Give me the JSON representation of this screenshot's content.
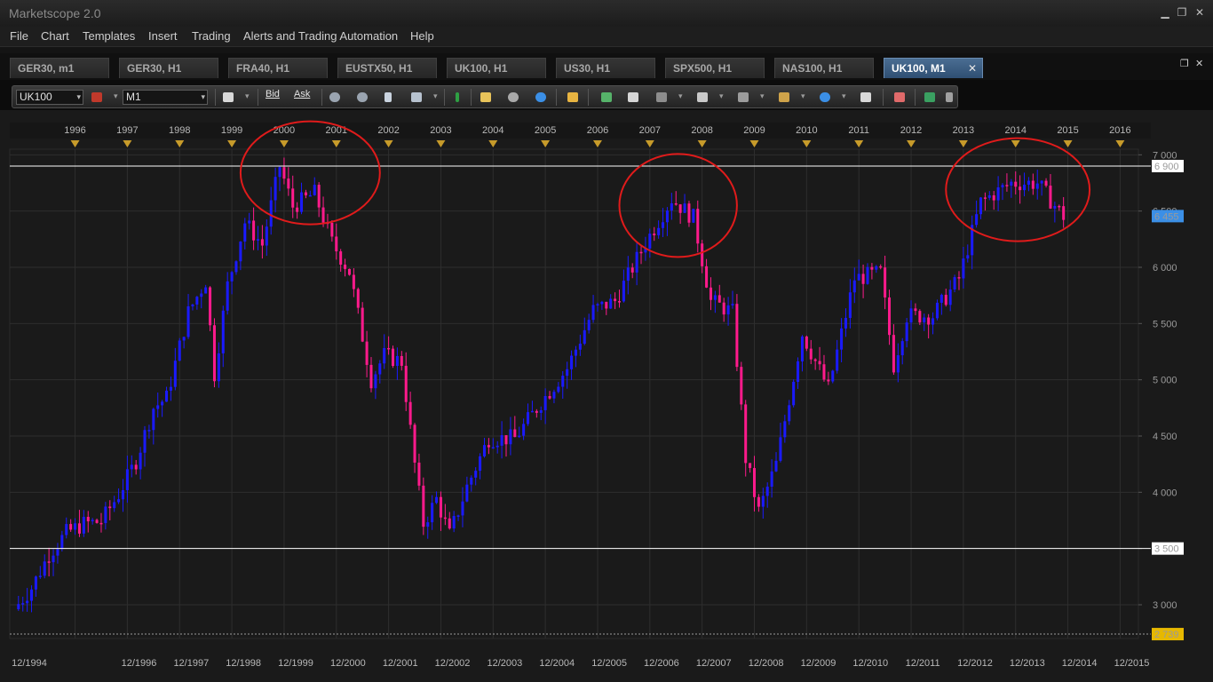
{
  "app": {
    "title": "Marketscope 2.0"
  },
  "window_controls": {
    "minimize": "▁",
    "restore": "❐",
    "close": "✕",
    "chart_restore": "❐",
    "chart_close": "✕"
  },
  "menu": [
    "File",
    "Chart",
    "Templates",
    "Insert",
    "Trading",
    "Alerts and Trading Automation",
    "Help"
  ],
  "tabs": [
    {
      "label": "GER30, m1",
      "active": false
    },
    {
      "label": "GER30, H1",
      "active": false
    },
    {
      "label": "FRA40, H1",
      "active": false
    },
    {
      "label": "EUSTX50, H1",
      "active": false
    },
    {
      "label": "UK100, H1",
      "active": false
    },
    {
      "label": "US30, H1",
      "active": false
    },
    {
      "label": "SPX500, H1",
      "active": false
    },
    {
      "label": "NAS100, H1",
      "active": false
    },
    {
      "label": "UK100, M1",
      "active": true
    }
  ],
  "tab_close": "✕",
  "toolbar": {
    "instrument": "UK100",
    "timeframe": "M1",
    "bid_label": "Bid",
    "ask_label": "Ask",
    "dropdown_glyph": "▾",
    "icons": [
      "chart-type-icon",
      "bid-icon",
      "ask-icon",
      "person-icon",
      "person2-icon",
      "cursor-icon",
      "zoom-icon",
      "crosshair-icon",
      "note-icon",
      "eye-icon",
      "globe-icon",
      "ruler-icon",
      "image-icon",
      "window-icon",
      "fibonacci-icon",
      "channel-icon",
      "trendline-icon",
      "line-icon",
      "ellipse-icon",
      "text-icon",
      "eraser-icon",
      "tree-icon",
      "menu-icon"
    ],
    "colors": {
      "accent_bid": "#4a90d9",
      "accent_ask": "#d94a4a"
    }
  },
  "chart_data": {
    "type": "candlestick",
    "instrument": "UK100",
    "timeframe": "M1",
    "top_axis_years": [
      "1996",
      "1997",
      "1998",
      "1999",
      "2000",
      "2001",
      "2002",
      "2003",
      "2004",
      "2005",
      "2006",
      "2007",
      "2008",
      "2009",
      "2010",
      "2011",
      "2012",
      "2013",
      "2014",
      "2015",
      "2016"
    ],
    "bottom_axis_labels": [
      "12/1994",
      "12/1996",
      "12/1997",
      "12/1998",
      "12/1999",
      "12/2000",
      "12/2001",
      "12/2002",
      "12/2003",
      "12/2004",
      "12/2005",
      "12/2006",
      "12/2007",
      "12/2008",
      "12/2009",
      "12/2010",
      "12/2011",
      "12/2012",
      "12/2013",
      "12/2014",
      "12/2015"
    ],
    "y_ticks": [
      "3 000",
      "3 500",
      "4 000",
      "4 500",
      "5 000",
      "5 500",
      "6 000",
      "6 500",
      "7 000"
    ],
    "ylim": [
      2700,
      7050
    ],
    "horizontal_lines": [
      {
        "value": 6900,
        "label": "6 900"
      },
      {
        "value": 3500,
        "label": "3 500"
      }
    ],
    "price_markers": [
      {
        "value": 6455,
        "label": "6 455",
        "color": "#3b8fe6"
      },
      {
        "value": 2739,
        "label": "2 739",
        "color": "#e6b800"
      }
    ],
    "colors": {
      "up": "#1a1aff",
      "down": "#ff1a8c",
      "background": "#1a1a1a",
      "grid": "#2e2e2e",
      "circles": "#e01b1b"
    },
    "highlight_circles": [
      {
        "from": "1999-03",
        "to": "2001-11"
      },
      {
        "from": "2006-06",
        "to": "2008-09"
      },
      {
        "from": "2012-09",
        "to": "2015-06"
      }
    ],
    "close_series": [
      {
        "period": "1994-11",
        "close": 2960
      },
      {
        "period": "1995-03",
        "close": 3150
      },
      {
        "period": "1995-07",
        "close": 3450
      },
      {
        "period": "1995-11",
        "close": 3640
      },
      {
        "period": "1996-03",
        "close": 3720
      },
      {
        "period": "1996-07",
        "close": 3740
      },
      {
        "period": "1996-11",
        "close": 3980
      },
      {
        "period": "1997-03",
        "close": 4280
      },
      {
        "period": "1997-07",
        "close": 4750
      },
      {
        "period": "1997-10",
        "close": 4840
      },
      {
        "period": "1998-03",
        "close": 5600
      },
      {
        "period": "1998-07",
        "close": 5880
      },
      {
        "period": "1998-09",
        "close": 5050
      },
      {
        "period": "1998-12",
        "close": 5840
      },
      {
        "period": "1999-04",
        "close": 6400
      },
      {
        "period": "1999-08",
        "close": 6200
      },
      {
        "period": "1999-12",
        "close": 6900
      },
      {
        "period": "2000-03",
        "close": 6540
      },
      {
        "period": "2000-08",
        "close": 6660
      },
      {
        "period": "2000-12",
        "close": 6220
      },
      {
        "period": "2001-04",
        "close": 5960
      },
      {
        "period": "2001-09",
        "close": 5000
      },
      {
        "period": "2001-12",
        "close": 5220
      },
      {
        "period": "2002-04",
        "close": 5160
      },
      {
        "period": "2002-07",
        "close": 4250
      },
      {
        "period": "2002-09",
        "close": 3720
      },
      {
        "period": "2002-12",
        "close": 3940
      },
      {
        "period": "2003-03",
        "close": 3620
      },
      {
        "period": "2003-07",
        "close": 4050
      },
      {
        "period": "2003-12",
        "close": 4480
      },
      {
        "period": "2004-06",
        "close": 4480
      },
      {
        "period": "2004-12",
        "close": 4800
      },
      {
        "period": "2005-06",
        "close": 5100
      },
      {
        "period": "2005-12",
        "close": 5620
      },
      {
        "period": "2006-05",
        "close": 5700
      },
      {
        "period": "2006-12",
        "close": 6220
      },
      {
        "period": "2007-06",
        "close": 6610
      },
      {
        "period": "2007-11",
        "close": 6440
      },
      {
        "period": "2008-03",
        "close": 5700
      },
      {
        "period": "2008-08",
        "close": 5600
      },
      {
        "period": "2008-11",
        "close": 4300
      },
      {
        "period": "2009-02",
        "close": 3830
      },
      {
        "period": "2009-06",
        "close": 4250
      },
      {
        "period": "2009-12",
        "close": 5410
      },
      {
        "period": "2010-06",
        "close": 4920
      },
      {
        "period": "2010-12",
        "close": 5900
      },
      {
        "period": "2011-06",
        "close": 5950
      },
      {
        "period": "2011-09",
        "close": 5130
      },
      {
        "period": "2011-12",
        "close": 5570
      },
      {
        "period": "2012-06",
        "close": 5570
      },
      {
        "period": "2012-12",
        "close": 5900
      },
      {
        "period": "2013-05",
        "close": 6580
      },
      {
        "period": "2013-12",
        "close": 6750
      },
      {
        "period": "2014-06",
        "close": 6750
      },
      {
        "period": "2014-10",
        "close": 6550
      },
      {
        "period": "2014-12",
        "close": 6455
      }
    ]
  }
}
